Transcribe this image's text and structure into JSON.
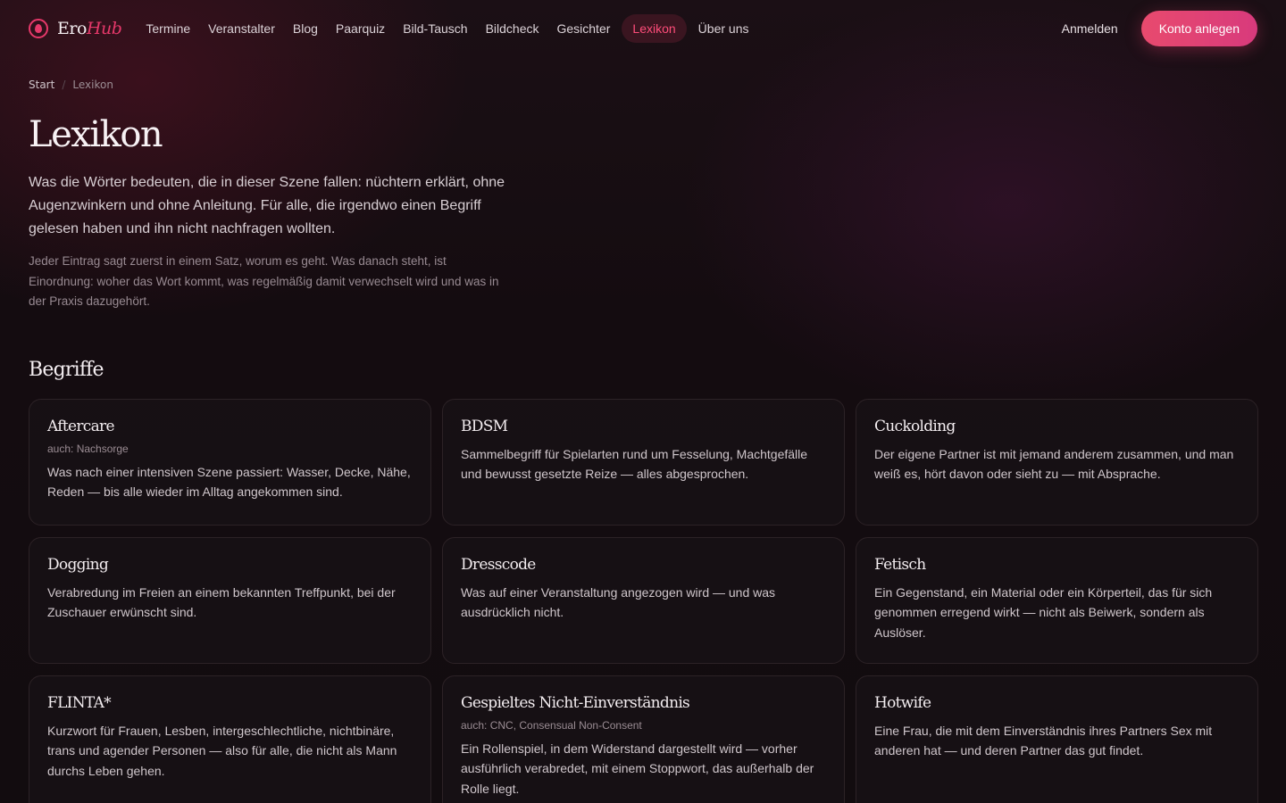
{
  "brand": {
    "name_part1": "Ero",
    "name_part2": "Hub"
  },
  "nav": {
    "links": [
      {
        "label": "Termine"
      },
      {
        "label": "Veranstalter"
      },
      {
        "label": "Blog"
      },
      {
        "label": "Paarquiz"
      },
      {
        "label": "Bild-Tausch"
      },
      {
        "label": "Bildcheck"
      },
      {
        "label": "Gesichter"
      },
      {
        "label": "Lexikon",
        "active": true
      },
      {
        "label": "Über uns"
      }
    ],
    "login_label": "Anmelden",
    "signup_label": "Konto anlegen"
  },
  "breadcrumb": {
    "home": "Start",
    "separator": "/",
    "current": "Lexikon"
  },
  "page": {
    "title": "Lexikon",
    "lead": "Was die Wörter bedeuten, die in dieser Szene fallen: nüchtern erklärt, ohne Augenzwinkern und ohne Anleitung. Für alle, die irgendwo einen Begriff gelesen haben und ihn nicht nachfragen wollten.",
    "sub": "Jeder Eintrag sagt zuerst in einem Satz, worum es geht. Was danach steht, ist Einordnung: woher das Wort kommt, was regelmäßig damit verwechselt wird und was in der Praxis dazugehört."
  },
  "section": {
    "title": "Begriffe"
  },
  "terms": [
    {
      "title": "Aftercare",
      "aka": "auch: Nachsorge",
      "text": "Was nach einer intensiven Szene passiert: Wasser, Decke, Nähe, Reden — bis alle wieder im Alltag angekommen sind."
    },
    {
      "title": "BDSM",
      "aka": "",
      "text": "Sammelbegriff für Spielarten rund um Fesselung, Machtgefälle und bewusst gesetzte Reize — alles abgesprochen."
    },
    {
      "title": "Cuckolding",
      "aka": "",
      "text": "Der eigene Partner ist mit jemand anderem zusammen, und man weiß es, hört davon oder sieht zu — mit Absprache."
    },
    {
      "title": "Dogging",
      "aka": "",
      "text": "Verabredung im Freien an einem bekannten Treffpunkt, bei der Zuschauer erwünscht sind."
    },
    {
      "title": "Dresscode",
      "aka": "",
      "text": "Was auf einer Veranstaltung angezogen wird — und was ausdrücklich nicht."
    },
    {
      "title": "Fetisch",
      "aka": "",
      "text": "Ein Gegenstand, ein Material oder ein Körperteil, das für sich genommen erregend wirkt — nicht als Beiwerk, sondern als Auslöser."
    },
    {
      "title": "FLINTA*",
      "aka": "",
      "text": "Kurzwort für Frauen, Lesben, intergeschlechtliche, nichtbinäre, trans und agender Personen — also für alle, die nicht als Mann durchs Leben gehen."
    },
    {
      "title": "Gespieltes Nicht-Einverständnis",
      "aka": "auch: CNC, Consensual Non-Consent",
      "text": "Ein Rollenspiel, in dem Widerstand dargestellt wird — vorher ausführlich verabredet, mit einem Stoppwort, das außerhalb der Rolle liegt."
    },
    {
      "title": "Hotwife",
      "aka": "",
      "text": "Eine Frau, die mit dem Einverständnis ihres Partners Sex mit anderen hat — und deren Partner das gut findet."
    }
  ]
}
